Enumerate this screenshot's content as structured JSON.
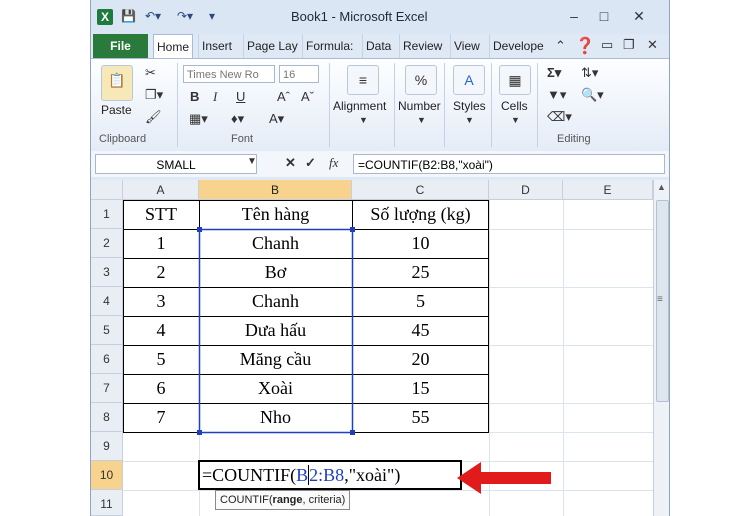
{
  "window": {
    "app_icon": "X",
    "title": "Book1 - Microsoft Excel",
    "controls": [
      "–",
      "□",
      "✕"
    ]
  },
  "tabs": [
    "File",
    "Home",
    "Insert",
    "Page Lay",
    "Formula:",
    "Data",
    "Review",
    "View",
    "Develope"
  ],
  "ribbon": {
    "clipboard": {
      "paste": "Paste",
      "group": "Clipboard"
    },
    "font": {
      "name": "Times New Ro",
      "size": "16",
      "bold": "B",
      "italic": "I",
      "underline": "U",
      "group": "Font"
    },
    "alignment": "Alignment",
    "number": "Number",
    "styles": "Styles",
    "cells": "Cells",
    "editing": "Editing"
  },
  "formula_bar": {
    "name_box": "SMALL",
    "fx": "fx",
    "formula": "=COUNTIF(B2:B8,\"xoài\")"
  },
  "columns": [
    "A",
    "B",
    "C",
    "D",
    "E"
  ],
  "rows": [
    "1",
    "2",
    "3",
    "4",
    "5",
    "6",
    "7",
    "8",
    "9",
    "10",
    "11"
  ],
  "table": {
    "headers": [
      "STT",
      "Tên hàng",
      "Số lượng (kg)"
    ],
    "rows": [
      [
        "1",
        "Chanh",
        "10"
      ],
      [
        "2",
        "Bơ",
        "25"
      ],
      [
        "3",
        "Chanh",
        "5"
      ],
      [
        "4",
        "Dưa hấu",
        "45"
      ],
      [
        "5",
        "Măng cầu",
        "20"
      ],
      [
        "6",
        "Xoài",
        "15"
      ],
      [
        "7",
        "Nho",
        "55"
      ]
    ]
  },
  "edit_cell": {
    "prefix": "=COUNTIF(",
    "range_start": "B",
    "range_rest": "2:B8",
    "suffix": ",\"xoài\")"
  },
  "tooltip": {
    "fn": "COUNTIF(",
    "arg1": "range",
    "rest": ", criteria)"
  },
  "colors": {
    "arrow": "#e11b1b",
    "selection_border": "#1f3fbf",
    "header_highlight": "#f8d38d",
    "file_tab": "#2a7a3b"
  }
}
